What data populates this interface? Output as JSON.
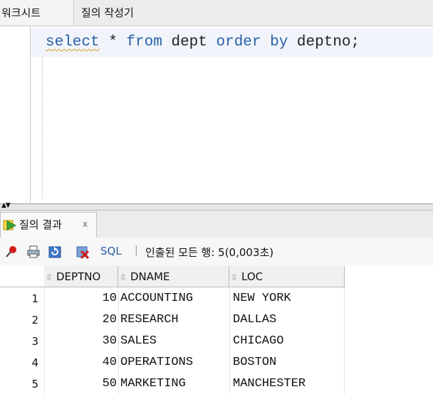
{
  "tabs": {
    "worksheet": "워크시트",
    "query_builder": "질의 작성기"
  },
  "editor": {
    "sql": [
      {
        "t": "select",
        "kw": true,
        "squig": true
      },
      {
        "t": " * ",
        "kw": false
      },
      {
        "t": "from",
        "kw": true
      },
      {
        "t": " dept ",
        "kw": false
      },
      {
        "t": "order by",
        "kw": true
      },
      {
        "t": " deptno;",
        "kw": false
      }
    ]
  },
  "results": {
    "tab_label": "질의 결과",
    "close_label": "x",
    "toolbar": {
      "icons": [
        "pin-icon",
        "print-icon",
        "refresh-icon",
        "cancel-icon"
      ],
      "sql_label": "SQL",
      "separator": "|",
      "status": "인출된 모든 행: 5(0,003초)"
    },
    "columns": [
      "DEPTNO",
      "DNAME",
      "LOC"
    ],
    "rows": [
      {
        "n": "1",
        "deptno": "10",
        "dname": "ACCOUNTING",
        "loc": "NEW YORK"
      },
      {
        "n": "2",
        "deptno": "20",
        "dname": "RESEARCH",
        "loc": "DALLAS"
      },
      {
        "n": "3",
        "deptno": "30",
        "dname": "SALES",
        "loc": "CHICAGO"
      },
      {
        "n": "4",
        "deptno": "40",
        "dname": "OPERATIONS",
        "loc": "BOSTON"
      },
      {
        "n": "5",
        "deptno": "50",
        "dname": "MARKETING",
        "loc": "MANCHESTER"
      }
    ]
  },
  "colors": {
    "keyword": "#2a5fa8",
    "link": "#2a5fa8",
    "pin": "#d11a1a",
    "play": "#3aa53a"
  }
}
